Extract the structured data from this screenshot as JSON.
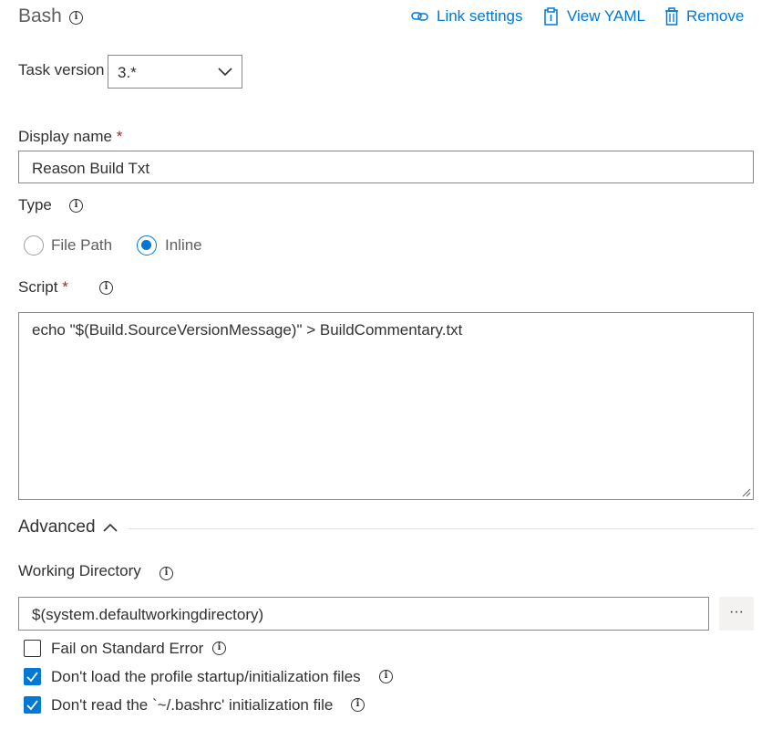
{
  "header": {
    "title": "Bash",
    "link_settings": "Link settings",
    "view_yaml": "View YAML",
    "remove": "Remove"
  },
  "task_version": {
    "label": "Task version",
    "value": "3.*"
  },
  "display_name": {
    "label": "Display name",
    "required_mark": "*",
    "value": "Reason Build Txt"
  },
  "type": {
    "label": "Type",
    "options": [
      {
        "label": "File Path",
        "selected": false
      },
      {
        "label": "Inline",
        "selected": true
      }
    ]
  },
  "script": {
    "label": "Script",
    "required_mark": "*",
    "value": "echo \"$(Build.SourceVersionMessage)\" > BuildCommentary.txt"
  },
  "advanced": {
    "label": "Advanced",
    "working_directory": {
      "label": "Working Directory",
      "value": "$(system.defaultworkingdirectory)",
      "browse_label": "···"
    },
    "checkboxes": [
      {
        "label": "Fail on Standard Error",
        "checked": false
      },
      {
        "label": "Don't load the profile startup/initialization files",
        "checked": true
      },
      {
        "label": "Don't read the `~/.bashrc' initialization file",
        "checked": true
      }
    ]
  },
  "colors": {
    "accent": "#0078d4",
    "required": "#a4262c",
    "border": "#8a8886",
    "text": "#323130"
  }
}
